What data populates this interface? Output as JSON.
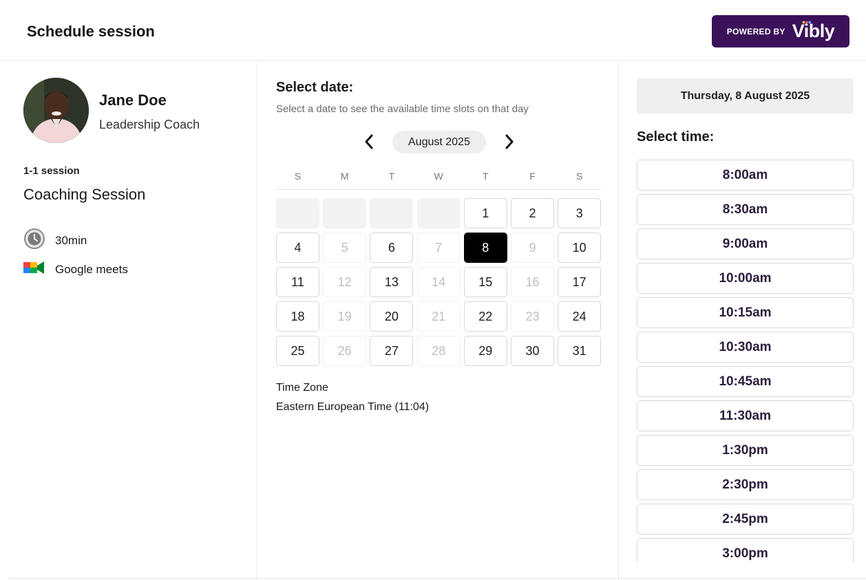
{
  "header": {
    "title": "Schedule session",
    "powered_label": "POWERED BY",
    "brand": "Vibly"
  },
  "coach": {
    "name": "Jane Doe",
    "role": "Leadership Coach"
  },
  "session": {
    "type": "1-1 session",
    "name": "Coaching Session",
    "duration": "30min",
    "platform": "Google meets"
  },
  "calendar": {
    "title": "Select date:",
    "subtitle": "Select a date to see the available time slots on that day",
    "month": "August 2025",
    "weekdays": [
      "S",
      "M",
      "T",
      "W",
      "T",
      "F",
      "S"
    ],
    "leading_empty_days": 4,
    "days": [
      {
        "n": "1",
        "state": "available"
      },
      {
        "n": "2",
        "state": "available"
      },
      {
        "n": "3",
        "state": "available"
      },
      {
        "n": "4",
        "state": "available"
      },
      {
        "n": "5",
        "state": "unavailable"
      },
      {
        "n": "6",
        "state": "available"
      },
      {
        "n": "7",
        "state": "unavailable"
      },
      {
        "n": "8",
        "state": "selected"
      },
      {
        "n": "9",
        "state": "unavailable"
      },
      {
        "n": "10",
        "state": "available"
      },
      {
        "n": "11",
        "state": "available"
      },
      {
        "n": "12",
        "state": "unavailable"
      },
      {
        "n": "13",
        "state": "available"
      },
      {
        "n": "14",
        "state": "unavailable"
      },
      {
        "n": "15",
        "state": "available"
      },
      {
        "n": "16",
        "state": "unavailable"
      },
      {
        "n": "17",
        "state": "available"
      },
      {
        "n": "18",
        "state": "available"
      },
      {
        "n": "19",
        "state": "unavailable"
      },
      {
        "n": "20",
        "state": "available"
      },
      {
        "n": "21",
        "state": "unavailable"
      },
      {
        "n": "22",
        "state": "available"
      },
      {
        "n": "23",
        "state": "unavailable"
      },
      {
        "n": "24",
        "state": "available"
      },
      {
        "n": "25",
        "state": "available"
      },
      {
        "n": "26",
        "state": "unavailable"
      },
      {
        "n": "27",
        "state": "available"
      },
      {
        "n": "28",
        "state": "unavailable"
      },
      {
        "n": "29",
        "state": "available"
      },
      {
        "n": "30",
        "state": "available"
      },
      {
        "n": "31",
        "state": "available"
      }
    ],
    "timezone_label": "Time Zone",
    "timezone_value": "Eastern European Time (11:04)"
  },
  "times": {
    "selected_date": "Thursday, 8 August 2025",
    "title": "Select time:",
    "slots": [
      "8:00am",
      "8:30am",
      "9:00am",
      "10:00am",
      "10:15am",
      "10:30am",
      "10:45am",
      "11:30am",
      "1:30pm",
      "2:30pm",
      "2:45pm",
      "3:00pm"
    ]
  },
  "colors": {
    "brand_purple": "#3b1159",
    "selected_day": "#000000",
    "slot_text": "#2b1c3d"
  },
  "icons": {
    "clock": "clock-icon",
    "meet": "google-meet-icon",
    "prev": "chevron-left-icon",
    "next": "chevron-right-icon"
  }
}
